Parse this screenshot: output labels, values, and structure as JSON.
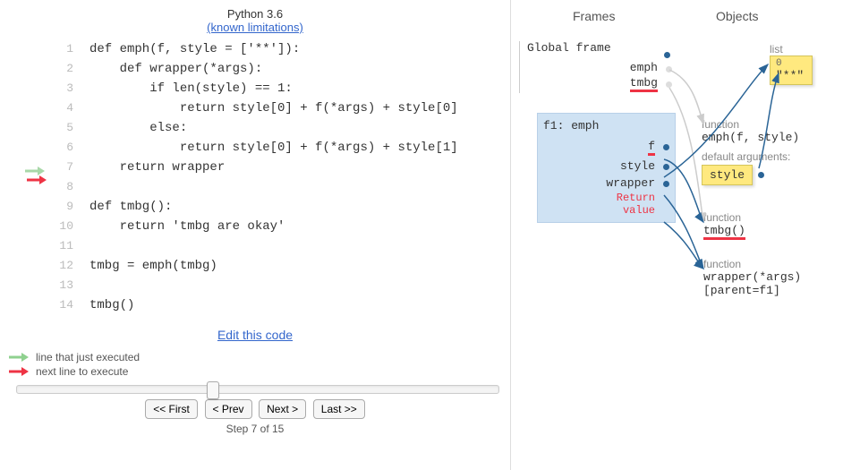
{
  "header": {
    "python_version": "Python 3.6",
    "limitations_link": "(known limitations)"
  },
  "code": {
    "lines": [
      "def emph(f, style = ['**']):",
      "    def wrapper(*args):",
      "        if len(style) == 1:",
      "            return style[0] + f(*args) + style[0]",
      "        else:",
      "            return style[0] + f(*args) + style[1]",
      "    return wrapper",
      "",
      "def tmbg():",
      "    return 'tmbg are okay'",
      "",
      "tmbg = emph(tmbg)",
      "",
      "tmbg()"
    ],
    "just_executed_line": 7,
    "next_line": 7
  },
  "edit_link": "Edit this code",
  "legend": {
    "just_executed": "line that just executed",
    "next_line": "next line to execute"
  },
  "controls": {
    "first": "<< First",
    "prev": "< Prev",
    "next": "Next >",
    "last": "Last >>"
  },
  "step": {
    "label": "Step 7 of 15",
    "current": 7,
    "total": 15
  },
  "columns": {
    "frames": "Frames",
    "objects": "Objects"
  },
  "frames": {
    "global": {
      "title": "Global frame",
      "rows": [
        "emph",
        "tmbg"
      ]
    },
    "f1": {
      "title": "f1: emph",
      "rows": [
        "f",
        "style",
        "wrapper"
      ],
      "return_label": "Return\nvalue"
    }
  },
  "objects": {
    "list": {
      "label": "list",
      "index": "0",
      "value": "\"**\""
    },
    "func_emph": {
      "label": "function",
      "sig": "emph(f, style)"
    },
    "default_args": {
      "label": "default arguments:",
      "name": "style"
    },
    "func_tmbg": {
      "label": "function",
      "sig": "tmbg()"
    },
    "func_wrapper": {
      "label": "function",
      "sig": "wrapper(*args) [parent=f1]"
    }
  }
}
